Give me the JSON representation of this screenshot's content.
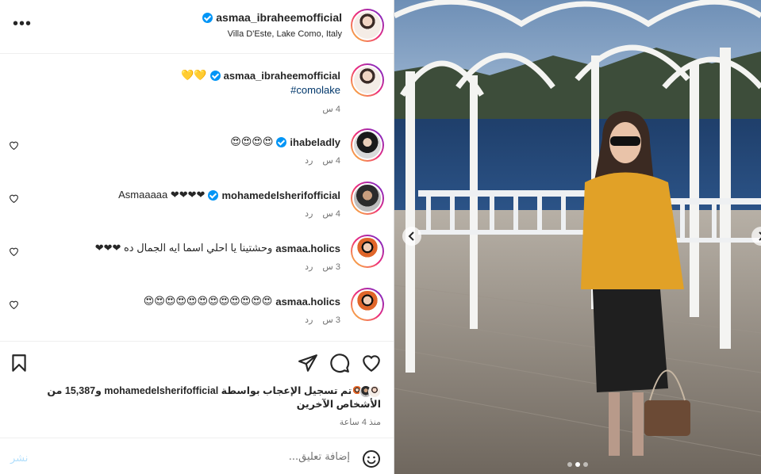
{
  "header": {
    "username": "asmaa_ibraheemofficial",
    "location": "Villa D'Este, Lake Como, Italy",
    "more_label": "•••"
  },
  "caption": {
    "emoji": "💛💛",
    "username": "asmaa_ibraheemofficial",
    "hashtag": "#comolake",
    "time": "4 س"
  },
  "comments": [
    {
      "username": "ihabeladly",
      "text": "😍😍😍😍",
      "time": "4 س",
      "reply": "رد"
    },
    {
      "username": "mohamedelsherifofficial",
      "text": "Asmaaaaa ❤❤❤❤",
      "time": "4 س",
      "reply": "رد"
    },
    {
      "username": "asmaa.holics",
      "text": "وحشتينا يا احلي اسما ايه الجمال ده ❤❤❤",
      "time": "3 س",
      "reply": "رد"
    },
    {
      "username": "asmaa.holics",
      "text": "😍😍😍😍😍😍😍😍😍😍😍😍",
      "time": "3 س",
      "reply": "رد"
    }
  ],
  "likes": {
    "text_prefix": "تم تسجيل الإعجاب بواسطة",
    "liker": "mohamedelsherifofficial",
    "text_suffix": "و15,387 من الأشخاص الآخرين"
  },
  "posted": "منذ 4 ساعة",
  "composer": {
    "placeholder": "إضافة تعليق...",
    "post_label": "نشر"
  },
  "icons": {
    "more": "more-options-icon",
    "verified": "verified-badge-icon",
    "heart": "heart-icon",
    "comment": "comment-icon",
    "share": "share-icon",
    "save": "bookmark-icon",
    "emoji": "emoji-icon"
  },
  "carousel": {
    "current": 2,
    "total": 3
  },
  "colors": {
    "verified": "#0095f6",
    "hashtag": "#00376b",
    "post_disabled": "#b2dffc",
    "meta": "#737373"
  }
}
